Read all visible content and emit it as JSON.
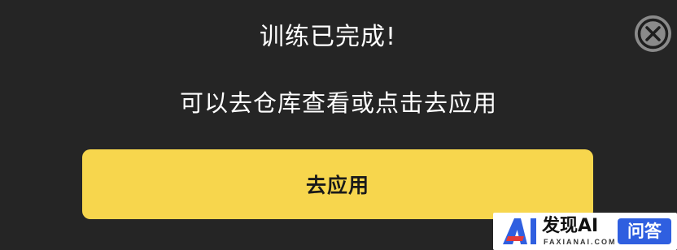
{
  "dialog": {
    "title": "训练已完成!",
    "message": "可以去仓库查看或点击去应用",
    "apply_button_label": "去应用",
    "close_icon": "close-icon"
  },
  "watermark": {
    "brand": "发现AI",
    "domain": "FAXIANAI.COM",
    "badge": "问答",
    "logo_letters": "AI",
    "colors": {
      "logo_primary": "#2f5fe0",
      "logo_accent": "#e23b3b"
    }
  },
  "colors": {
    "background": "#252525",
    "accent_button": "#f7d64d",
    "close_button": "#8a8a8a"
  }
}
